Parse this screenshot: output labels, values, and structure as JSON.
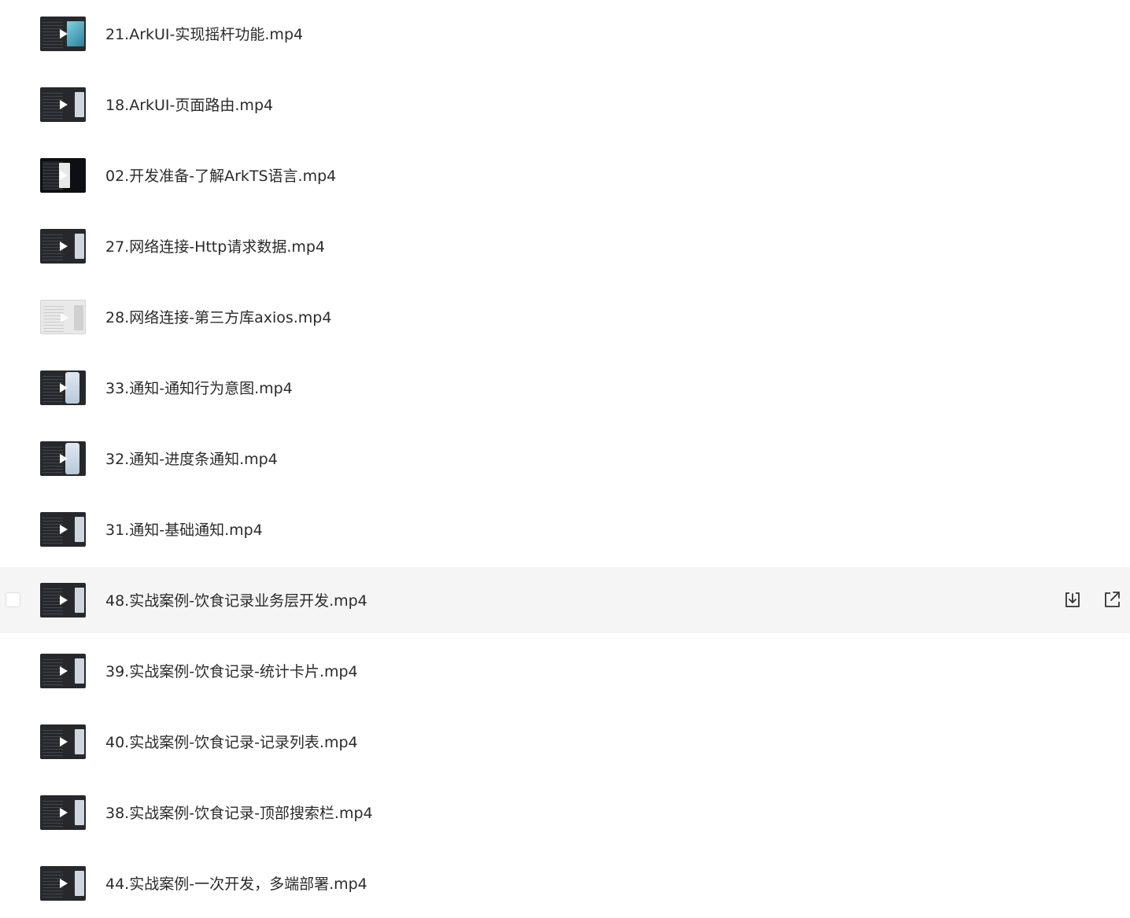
{
  "files": [
    {
      "name": "21.ArkUI-实现摇杆功能.mp4",
      "thumb": "teal"
    },
    {
      "name": "18.ArkUI-页面路由.mp4",
      "thumb": "normal"
    },
    {
      "name": "02.开发准备-了解ArkTS语言.mp4",
      "thumb": "dark"
    },
    {
      "name": "27.网络连接-Http请求数据.mp4",
      "thumb": "normal"
    },
    {
      "name": "28.网络连接-第三方库axios.mp4",
      "thumb": "light"
    },
    {
      "name": "33.通知-通知行为意图.mp4",
      "thumb": "phone"
    },
    {
      "name": "32.通知-进度条通知.mp4",
      "thumb": "phone"
    },
    {
      "name": "31.通知-基础通知.mp4",
      "thumb": "normal"
    },
    {
      "name": "48.实战案例-饮食记录业务层开发.mp4",
      "thumb": "normal",
      "hovered": true
    },
    {
      "name": "39.实战案例-饮食记录-统计卡片.mp4",
      "thumb": "normal"
    },
    {
      "name": "40.实战案例-饮食记录-记录列表.mp4",
      "thumb": "normal"
    },
    {
      "name": "38.实战案例-饮食记录-顶部搜索栏.mp4",
      "thumb": "normal"
    },
    {
      "name": "44.实战案例-一次开发，多端部署.mp4",
      "thumb": "normal"
    }
  ],
  "actions": {
    "download_icon": "download-icon",
    "share_icon": "external-link-icon"
  },
  "colors": {
    "hover_background": "#f5f5f6",
    "text": "#2b2b2b",
    "icon": "#333333"
  }
}
